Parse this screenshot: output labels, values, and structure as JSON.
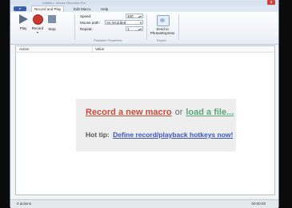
{
  "window": {
    "title": "Untitled - Mouse Recorder Pro",
    "close_glyph": "x"
  },
  "menu": {
    "file_glyph": "▾"
  },
  "tabs": [
    {
      "label": "Record and Play",
      "active": true
    },
    {
      "label": "Edit Macro",
      "active": false
    },
    {
      "label": "Help",
      "active": false
    }
  ],
  "ribbon": {
    "buttons": {
      "play": "Play",
      "record": "Record",
      "record_caret": "▾",
      "stop": "Stop"
    },
    "properties": {
      "speed_label": "Speed:",
      "speed_value": "100",
      "mouse_path_label": "Mouse path:",
      "mouse_path_value": "As recorded",
      "repeat_label": "Repeat:",
      "repeat_value": "1",
      "group_label": "Playback Properties"
    },
    "export": {
      "send_label_1": "Send to",
      "send_label_2": "PhraseExpress",
      "group_label": "Export"
    }
  },
  "list": {
    "columns": [
      "Action",
      "Value"
    ]
  },
  "message": {
    "record_link": "Record a new macro",
    "or_text": "or",
    "load_link": "load a file...",
    "hot_tip_label": "Hot tip:",
    "hotkeys_link": "Define record/playback hotkeys now!"
  },
  "statusbar": {
    "actions": "0 actions",
    "time": "00:00:00"
  },
  "colors": {
    "record_red": "#c0503a",
    "load_green": "#5aa77a",
    "tip_blue": "#3b55b8"
  }
}
